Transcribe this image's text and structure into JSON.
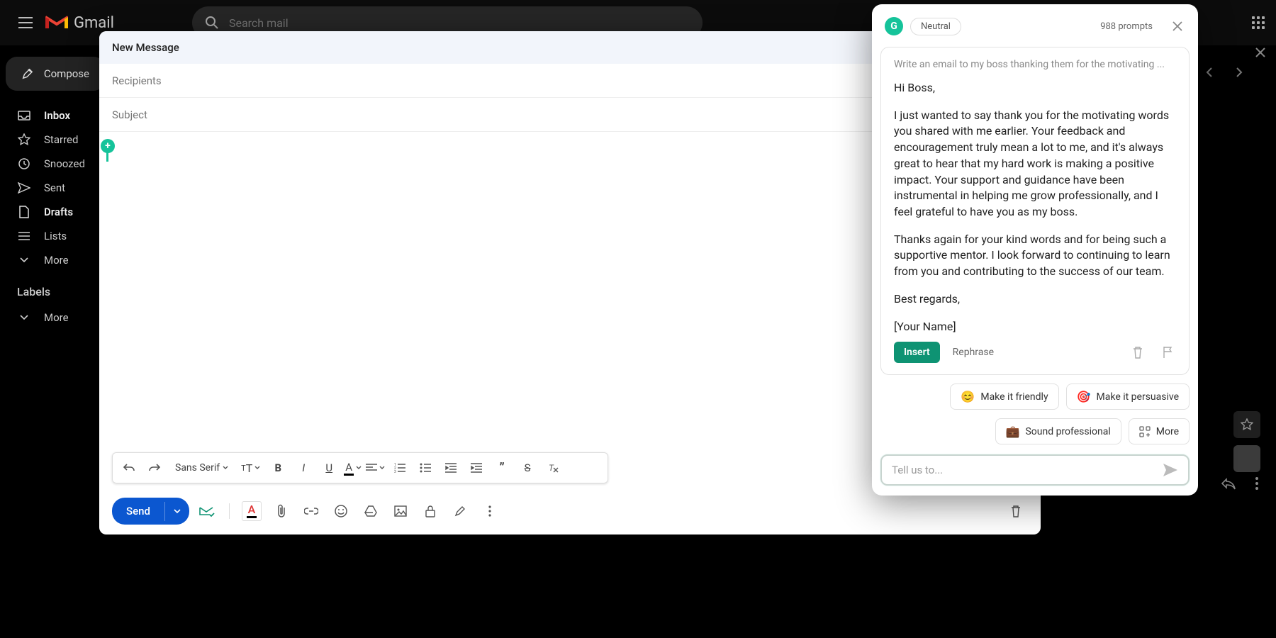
{
  "header": {
    "product": "Gmail",
    "search_placeholder": "Search mail"
  },
  "compose": {
    "button_label": "Compose",
    "window_title": "New Message",
    "recipients_placeholder": "Recipients",
    "subject_placeholder": "Subject",
    "send_label": "Send",
    "font_name": "Sans Serif"
  },
  "sidebar": {
    "items": [
      {
        "label": "Inbox",
        "bold": true
      },
      {
        "label": "Starred",
        "bold": false
      },
      {
        "label": "Snoozed",
        "bold": false
      },
      {
        "label": "Sent",
        "bold": false
      },
      {
        "label": "Drafts",
        "bold": true
      },
      {
        "label": "Lists",
        "bold": false
      },
      {
        "label": "More",
        "bold": false
      }
    ],
    "labels_header": "Labels",
    "labels_more": "More"
  },
  "grammarly": {
    "tone": "Neutral",
    "prompts_count": "988 prompts",
    "instruction": "Write an email to my boss thanking them for the motivating ...",
    "greeting": "Hi Boss,",
    "para1": "I just wanted to say thank you for the motivating words you shared with me earlier. Your feedback and encouragement truly mean a lot to me, and it's always great to hear that my hard work is making a positive impact. Your support and guidance have been instrumental in helping me grow professionally, and I feel grateful to have you as my boss.",
    "para2": "Thanks again for your kind words and for being such a supportive mentor. I look forward to continuing to learn from you and contributing to the success of our team.",
    "signoff": "Best regards,",
    "name": "[Your Name]",
    "insert_label": "Insert",
    "rephrase_label": "Rephrase",
    "chips": {
      "friendly": "Make it friendly",
      "persuasive": "Make it persuasive",
      "professional": "Sound professional",
      "more": "More"
    },
    "input_placeholder": "Tell us to..."
  }
}
